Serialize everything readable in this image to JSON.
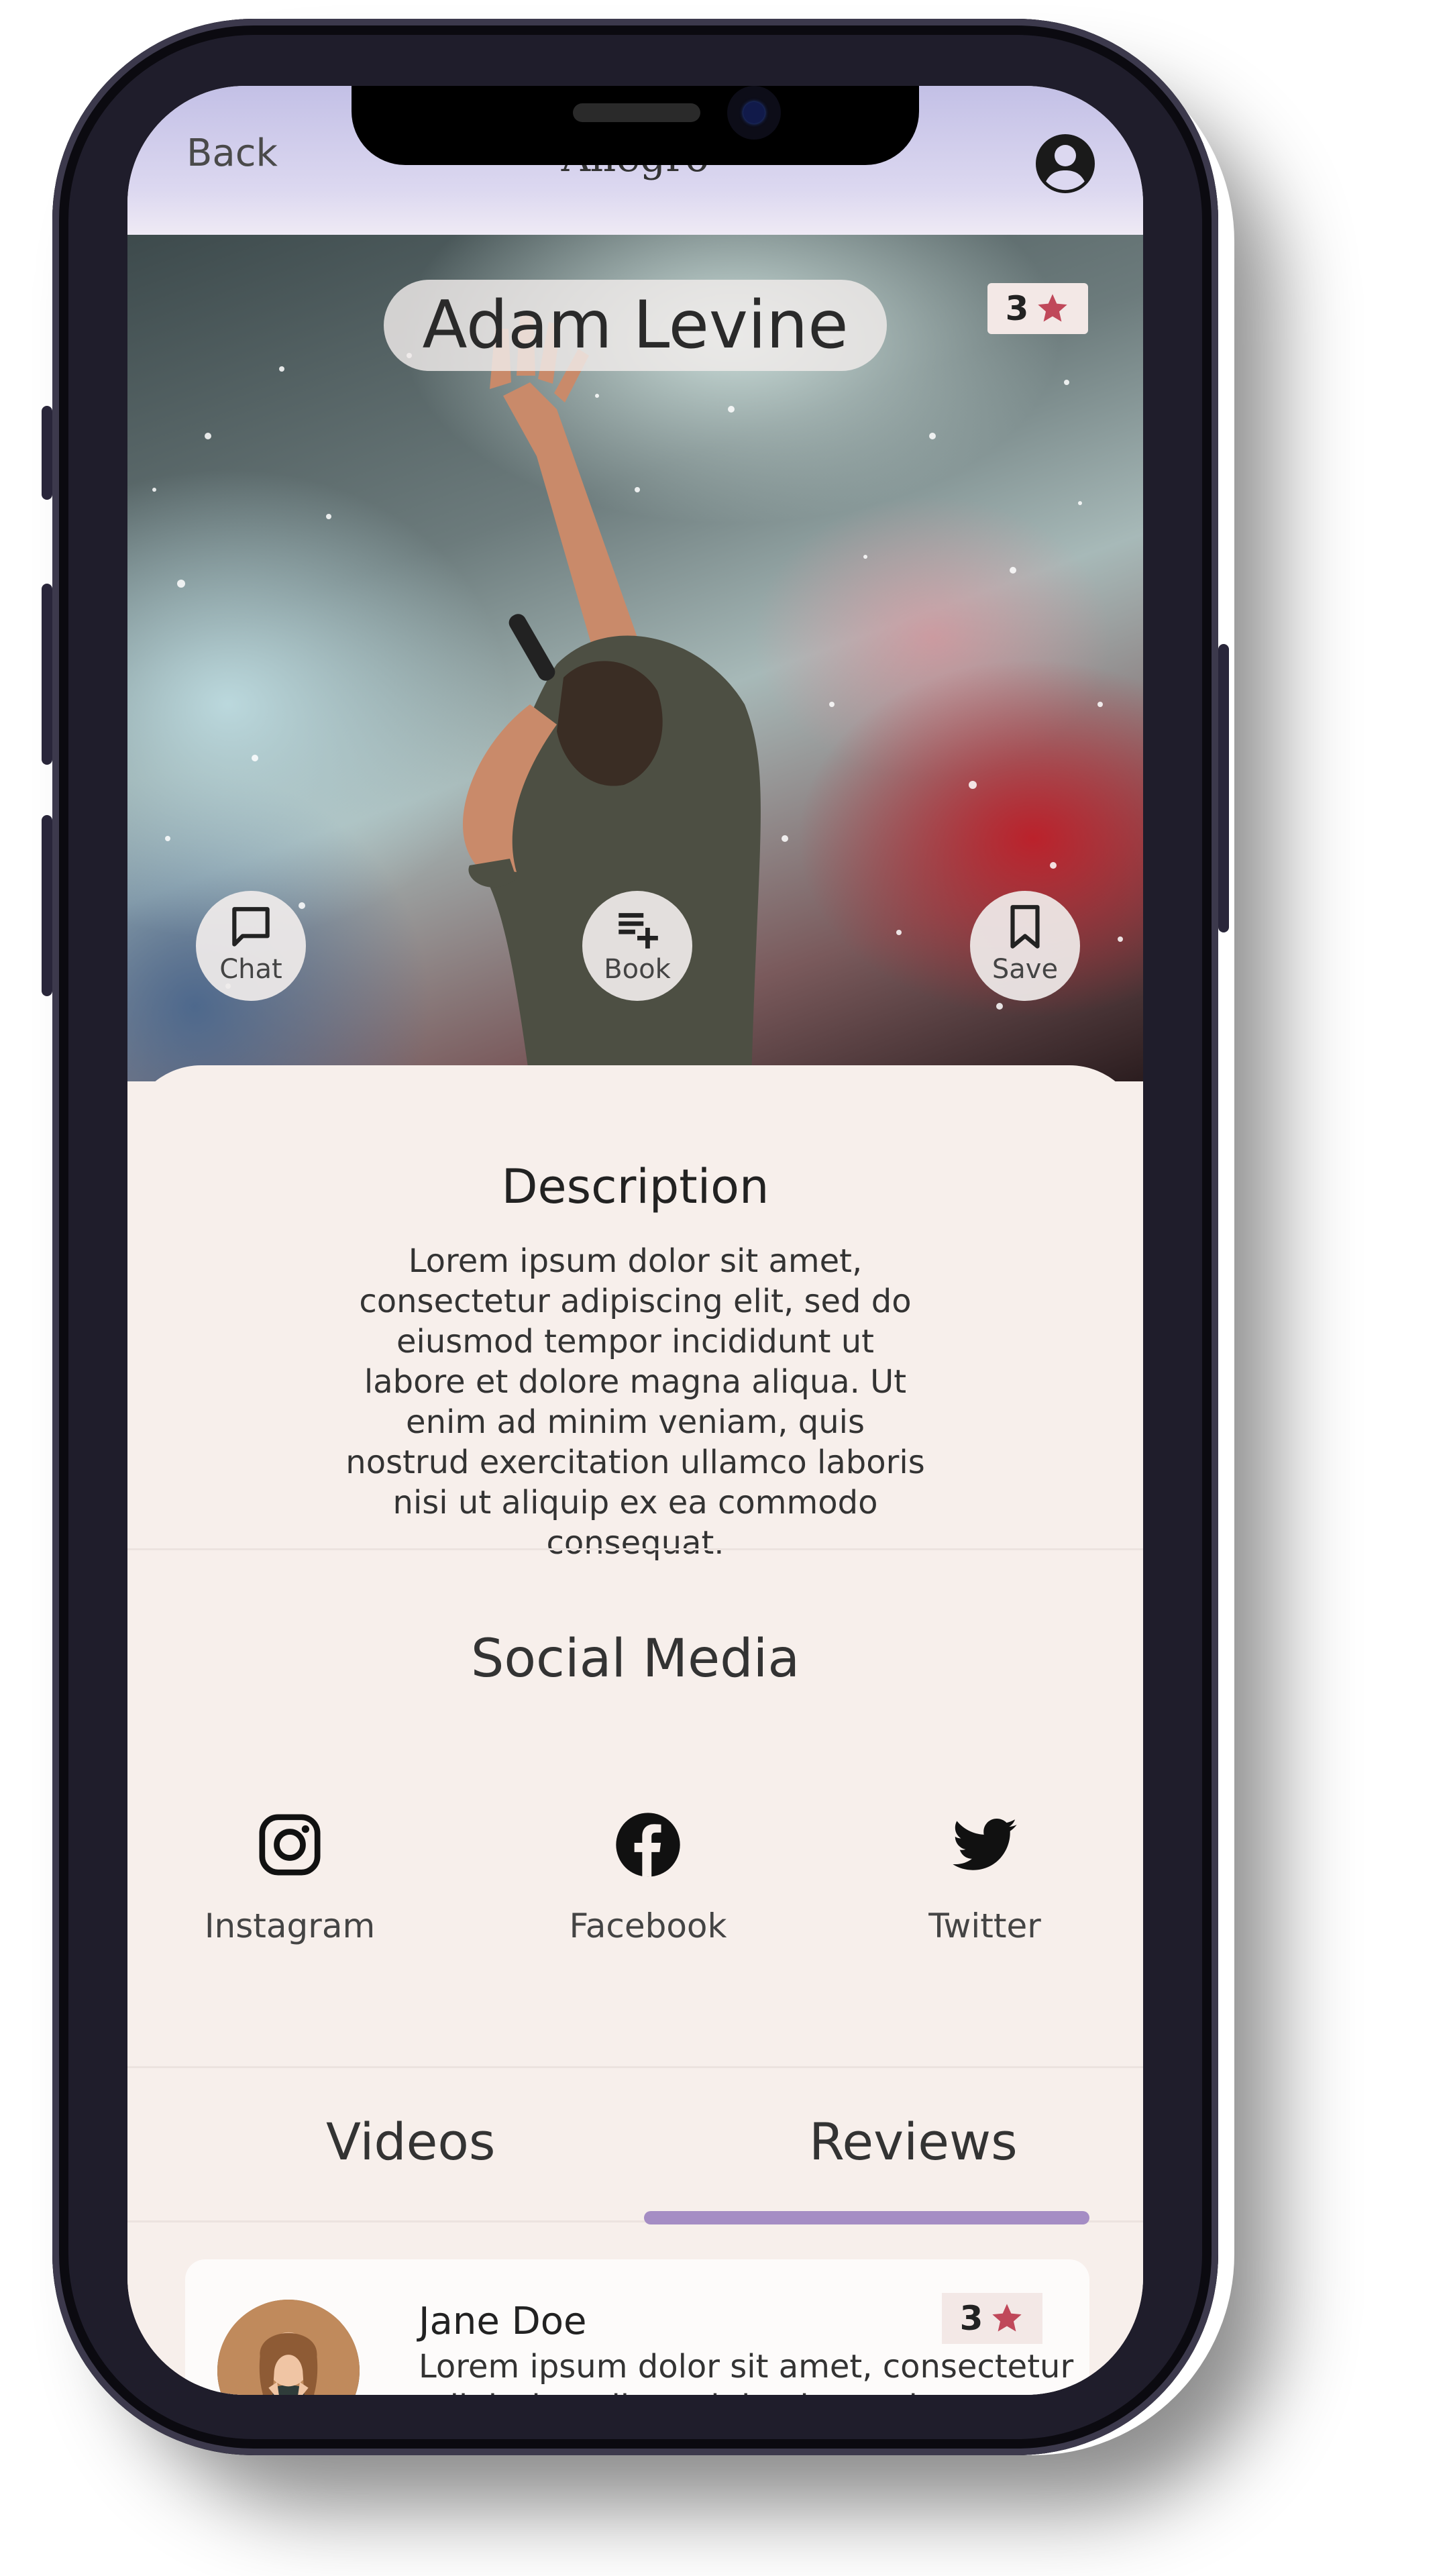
{
  "header": {
    "back_label": "Back",
    "app_title": "Allegro"
  },
  "artist": {
    "name": "Adam Levine",
    "rating": "3"
  },
  "actions": [
    {
      "label": "Chat",
      "icon": "chat-icon"
    },
    {
      "label": "Book",
      "icon": "playlist-add-icon"
    },
    {
      "label": "Save",
      "icon": "bookmark-icon"
    }
  ],
  "description": {
    "title": "Description",
    "text": "Lorem ipsum dolor sit amet, consectetur adipiscing elit, sed do eiusmod tempor incididunt ut labore et dolore magna aliqua. Ut enim ad minim veniam, quis nostrud exercitation ullamco laboris nisi ut aliquip ex ea commodo consequat."
  },
  "social": {
    "title": "Social Media",
    "items": [
      {
        "label": "Instagram",
        "icon": "instagram-icon"
      },
      {
        "label": "Facebook",
        "icon": "facebook-icon"
      },
      {
        "label": "Twitter",
        "icon": "twitter-icon"
      }
    ]
  },
  "tabs": [
    {
      "label": "Videos",
      "active": false
    },
    {
      "label": "Reviews",
      "active": true
    }
  ],
  "reviews": [
    {
      "name": "Jane Doe",
      "rating": "3",
      "text": "Lorem ipsum dolor sit amet, consectetur adipiscing elit, sed do eiusmod tempor incididunt ut labore et dolore magna aliqua."
    }
  ],
  "colors": {
    "header_gradient": "#c3c0e6",
    "card_background": "#f7efeb",
    "star": "#c0485a",
    "tab_indicator": "#a58dc4"
  }
}
